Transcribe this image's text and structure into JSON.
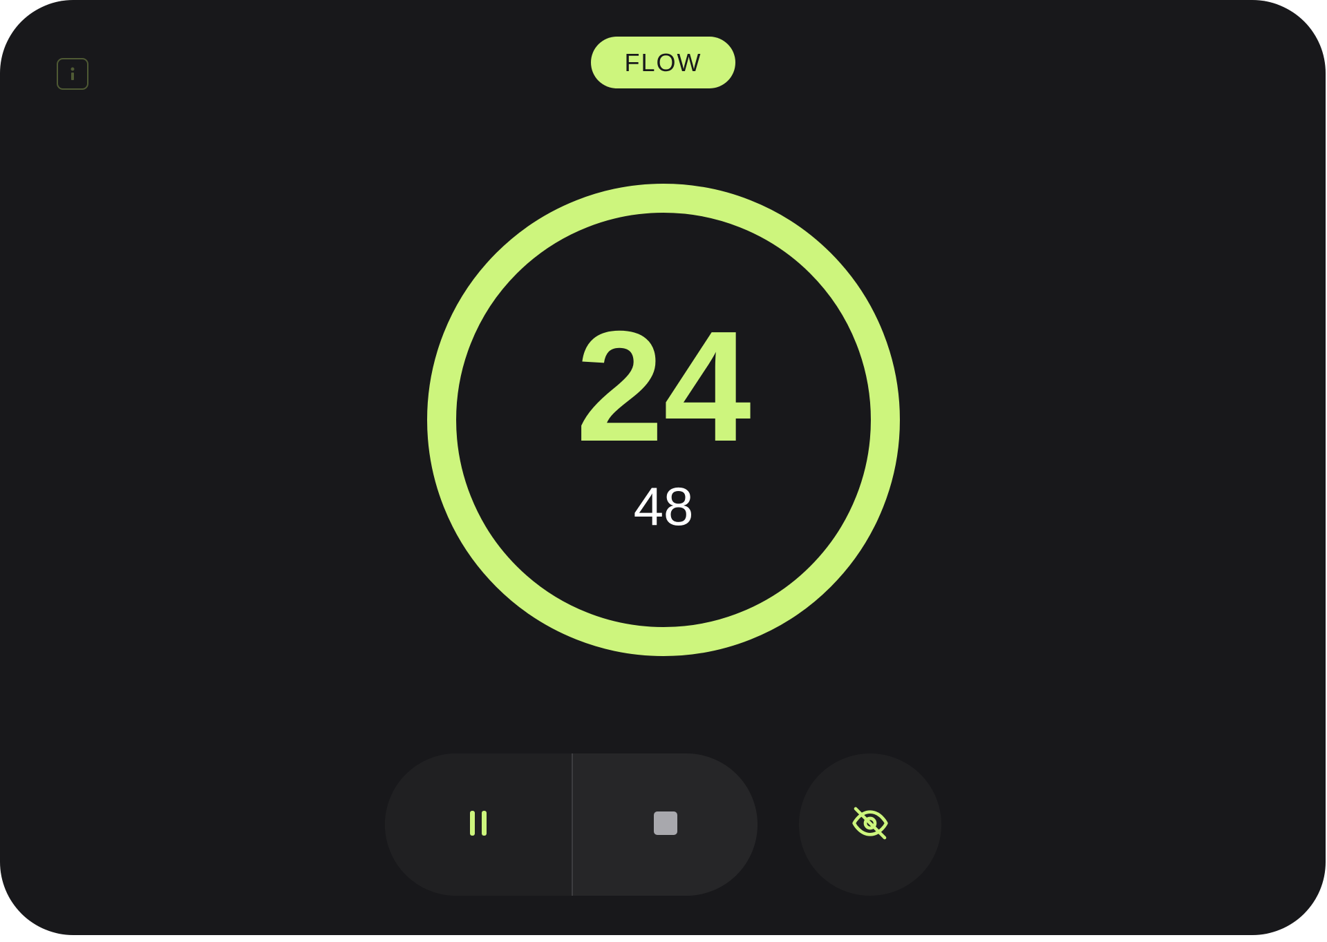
{
  "colors": {
    "accent": "#cdf57d",
    "background": "#18181b",
    "control_background": "#232326",
    "stop_icon": "#a8a8ad",
    "secondary_text": "#ffffff",
    "info_border": "#4f5a34"
  },
  "header": {
    "info_icon": "info-icon",
    "mode_label": "FLOW"
  },
  "timer": {
    "primary_value": "24",
    "secondary_value": "48"
  },
  "controls": {
    "pause_icon": "pause-icon",
    "stop_icon": "stop-icon",
    "visibility_icon": "eye-off-icon"
  }
}
